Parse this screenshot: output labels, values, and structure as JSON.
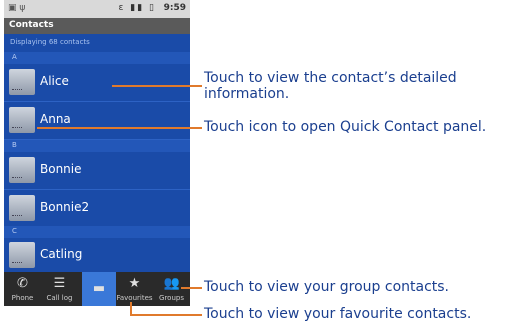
{
  "status_bar": {
    "time": "9:59"
  },
  "title_bar": {
    "title": "Contacts"
  },
  "list_info": "Displaying 68 contacts",
  "sections": [
    {
      "letter": "A",
      "contacts": [
        "Alice",
        "Anna"
      ]
    },
    {
      "letter": "B",
      "contacts": [
        "Bonnie",
        "Bonnie2"
      ]
    },
    {
      "letter": "C",
      "contacts": [
        "Catling"
      ]
    }
  ],
  "tabs": [
    {
      "label": "Phone",
      "icon": "phone-icon"
    },
    {
      "label": "Call log",
      "icon": "call-log-icon"
    },
    {
      "label": "",
      "icon": "contacts-icon",
      "selected": true
    },
    {
      "label": "Favourites",
      "icon": "star-icon"
    },
    {
      "label": "Groups",
      "icon": "groups-icon"
    }
  ],
  "callouts": {
    "detail_line1": "Touch to view the contact’s detailed",
    "detail_line2": "information.",
    "quick_contact": "Touch icon to open Quick Contact panel.",
    "groups": "Touch to view your group contacts.",
    "favourites": "Touch to view your favourite contacts."
  },
  "colors": {
    "accent_line": "#e07a2c",
    "screen_bg": "#1a4ba8",
    "callout_text": "#1b3f8f"
  }
}
